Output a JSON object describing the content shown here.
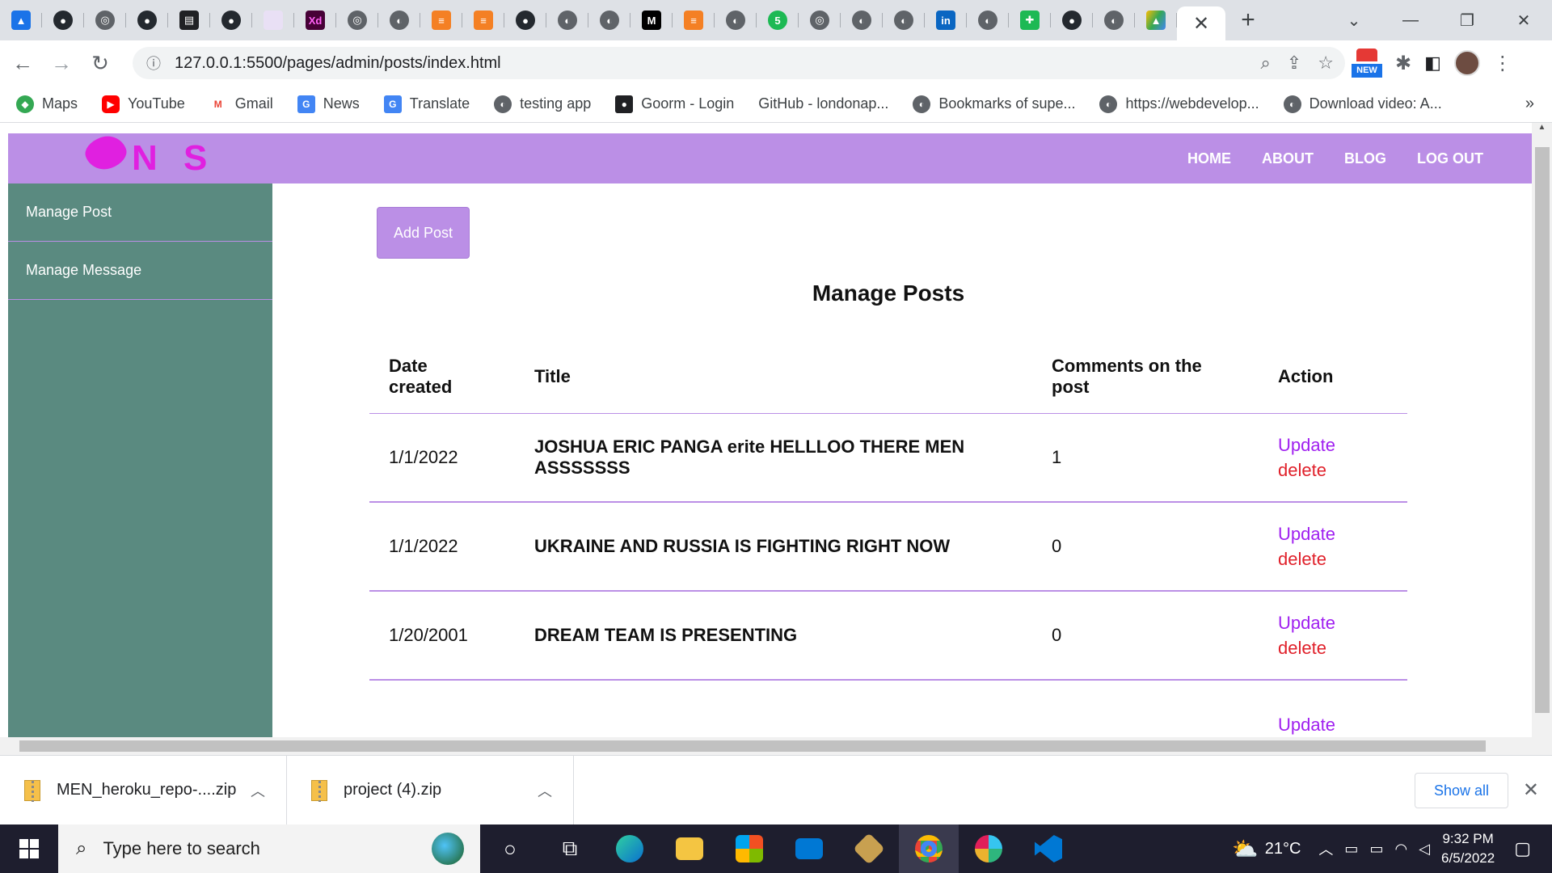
{
  "browser": {
    "tabs_close_glyph": "✕",
    "new_tab_glyph": "+",
    "url": "127.0.0.1:5500/pages/admin/posts/index.html",
    "ext_new_badge": "NEW",
    "bookmarks": [
      {
        "label": "Maps",
        "color": "#34a853"
      },
      {
        "label": "YouTube",
        "color": "#ff0000"
      },
      {
        "label": "Gmail",
        "color": "#ea4335"
      },
      {
        "label": "News",
        "color": "#4285f4"
      },
      {
        "label": "Translate",
        "color": "#4285f4"
      },
      {
        "label": "testing app",
        "color": "#5f6368"
      },
      {
        "label": "Goorm - Login",
        "color": "#202124"
      },
      {
        "label": "GitHub - londonap...",
        "color": "#ffffff"
      },
      {
        "label": "Bookmarks of supe...",
        "color": "#5f6368"
      },
      {
        "label": "https://webdevelop...",
        "color": "#5f6368"
      },
      {
        "label": "Download video: A...",
        "color": "#5f6368"
      }
    ],
    "bookmarks_more": "»"
  },
  "site": {
    "logo_text": "N S",
    "nav": [
      "HOME",
      "ABOUT",
      "BLOG",
      "LOG OUT"
    ],
    "accent": "#bb8fe6",
    "sidebar_color": "#5a8a80"
  },
  "sidebar": {
    "items": [
      "Manage Post",
      "Manage Message"
    ]
  },
  "main": {
    "add_button": "Add Post",
    "title": "Manage Posts",
    "columns": [
      "Date created",
      "Title",
      "Comments on the post",
      "Action"
    ],
    "rows": [
      {
        "date": "1/1/2022",
        "title": "JOSHUA ERIC PANGA erite HELLLOO THERE MEN ASSSSSSS",
        "comments": "1",
        "update": "Update",
        "delete": "delete"
      },
      {
        "date": "1/1/2022",
        "title": "UKRAINE AND RUSSIA IS FIGHTING RIGHT NOW",
        "comments": "0",
        "update": "Update",
        "delete": "delete"
      },
      {
        "date": "1/20/2001",
        "title": "DREAM TEAM IS PRESENTING",
        "comments": "0",
        "update": "Update",
        "delete": "delete"
      },
      {
        "date": "",
        "title": "",
        "comments": "",
        "update": "Update",
        "delete": ""
      }
    ]
  },
  "downloads": {
    "items": [
      "MEN_heroku_repo-....zip",
      "project (4).zip"
    ],
    "show_all": "Show all"
  },
  "taskbar": {
    "search_placeholder": "Type here to search",
    "temperature": "21°C",
    "time": "9:32 PM",
    "date": "6/5/2022"
  }
}
